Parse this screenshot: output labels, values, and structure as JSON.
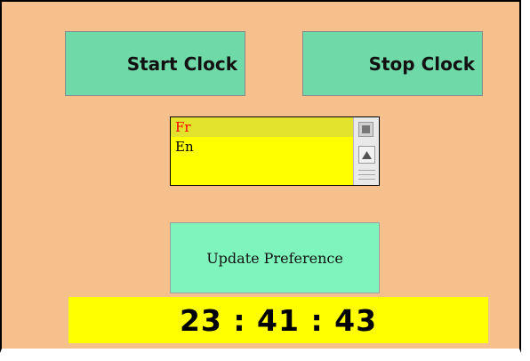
{
  "buttons": {
    "start_label": "Start Clock",
    "stop_label": "Stop Clock",
    "update_label": "Update Preference"
  },
  "language_list": {
    "items": [
      {
        "label": "Fr",
        "selected": true
      },
      {
        "label": "En",
        "selected": false
      }
    ]
  },
  "clock": {
    "time": "23 : 41 : 43"
  },
  "colors": {
    "background": "#f6c08d",
    "button_green": "#6fd9a8",
    "update_button": "#7ff5bd",
    "highlight_yellow": "#ffff00",
    "selected_text": "#ff0000"
  },
  "icons": {
    "scroll_thumb": "scrollbar-thumb-icon",
    "scroll_up": "scroll-up-arrow-icon"
  }
}
